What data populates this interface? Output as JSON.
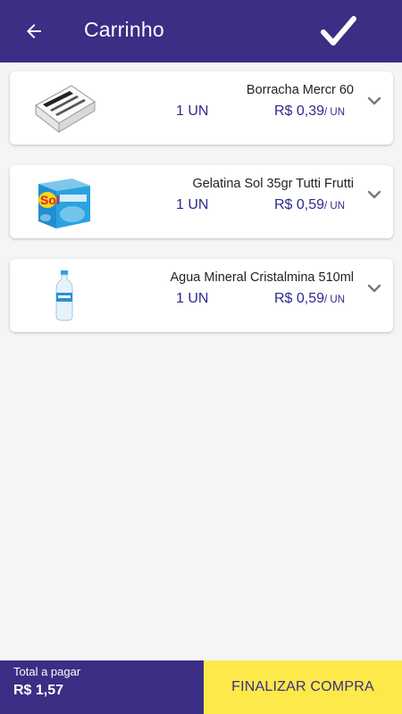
{
  "header": {
    "title": "Carrinho",
    "back_icon": "arrow-left-icon",
    "confirm_icon": "checkmark-icon"
  },
  "cart": {
    "items": [
      {
        "name": "Borracha Mercr 60",
        "quantity": "1 UN",
        "price": "R$ 0,39",
        "unit": "/ UN",
        "image": "eraser-product-image"
      },
      {
        "name": "Gelatina Sol 35gr Tutti Frutti",
        "quantity": "1 UN",
        "price": "R$ 0,59",
        "unit": "/ UN",
        "image": "gelatin-box-product-image"
      },
      {
        "name": "Agua Mineral Cristalmina 510ml",
        "quantity": "1 UN",
        "price": "R$ 0,59",
        "unit": "/ UN",
        "image": "water-bottle-product-image"
      }
    ]
  },
  "footer": {
    "total_label": "Total a pagar",
    "total_value": "R$ 1,57",
    "finalize_label": "FINALIZAR COMPRA"
  },
  "colors": {
    "primary": "#3a2e85",
    "accent": "#fde94a",
    "price_text": "#2e2a8a",
    "background": "#f5f5f5"
  }
}
